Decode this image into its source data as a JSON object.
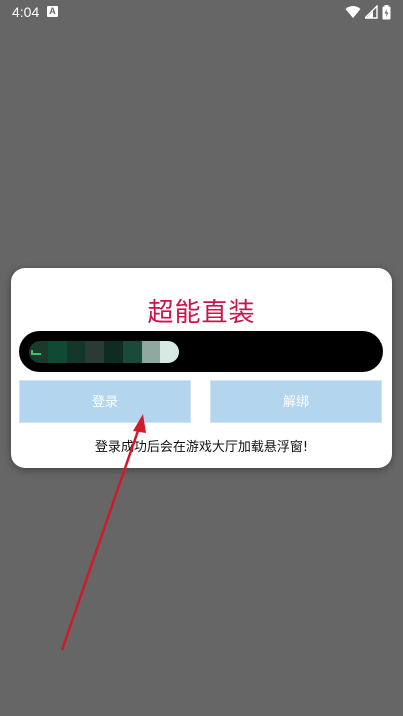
{
  "status_bar": {
    "time": "4:04",
    "notification_icon": "a-icon",
    "icons": [
      "wifi-icon",
      "signal-icon",
      "battery-charging-icon"
    ]
  },
  "dialog": {
    "title": "超能直装",
    "key_input": {
      "value_obscured": true
    },
    "login_label": "登录",
    "unbind_label": "解绑",
    "note": "登录成功后会在游戏大厅加载悬浮窗!"
  },
  "colors": {
    "overlay": "#666666",
    "title": "#c9154a",
    "button": "#b3d6ee",
    "input_bg": "#000000",
    "annotation_arrow": "#d11a2a"
  }
}
